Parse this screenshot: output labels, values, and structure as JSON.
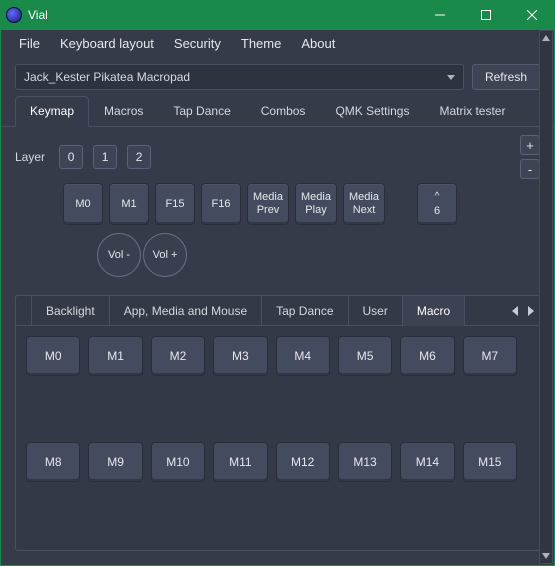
{
  "window": {
    "title": "Vial"
  },
  "menu": {
    "file": "File",
    "keyboard_layout": "Keyboard layout",
    "security": "Security",
    "theme": "Theme",
    "about": "About"
  },
  "device": {
    "selected": "Jack_Kester Pikatea Macropad",
    "refresh": "Refresh"
  },
  "tabs": {
    "keymap": "Keymap",
    "macros": "Macros",
    "tapdance": "Tap Dance",
    "combos": "Combos",
    "qmk": "QMK Settings",
    "matrix": "Matrix tester"
  },
  "layer": {
    "label": "Layer",
    "b0": "0",
    "b1": "1",
    "b2": "2",
    "plus": "+",
    "minus": "-"
  },
  "keys": {
    "k0": "M0",
    "k1": "M1",
    "k2": "F15",
    "k3": "F16",
    "k4": "Media\nPrev",
    "k5": "Media\nPlay",
    "k6": "Media\nNext",
    "rotTop": "^",
    "rotBottom": "6",
    "knobL": "Vol -",
    "knobR": "Vol +"
  },
  "panel_tabs": {
    "backlight": "Backlight",
    "app": "App, Media and Mouse",
    "tapdance": "Tap Dance",
    "user": "User",
    "macro": "Macro"
  },
  "macros": {
    "m0": "M0",
    "m1": "M1",
    "m2": "M2",
    "m3": "M3",
    "m4": "M4",
    "m5": "M5",
    "m6": "M6",
    "m7": "M7",
    "m8": "M8",
    "m9": "M9",
    "m10": "M10",
    "m11": "M11",
    "m12": "M12",
    "m13": "M13",
    "m14": "M14",
    "m15": "M15"
  }
}
